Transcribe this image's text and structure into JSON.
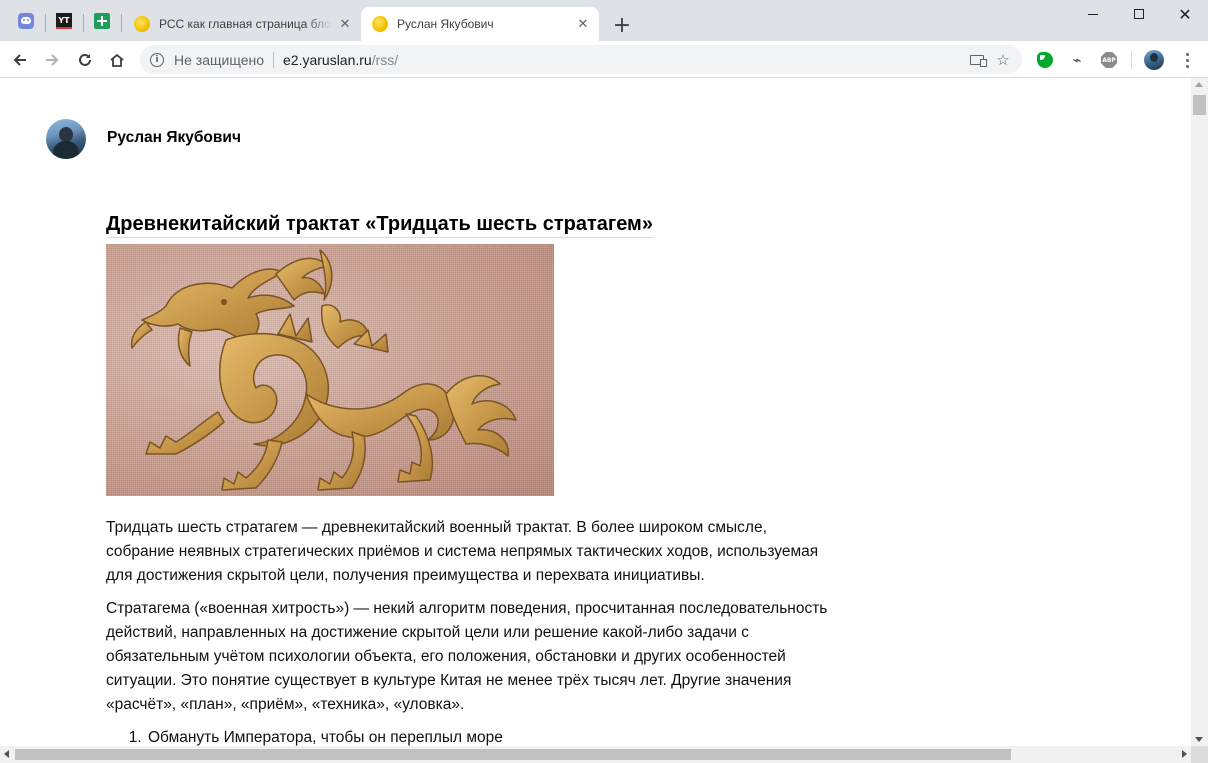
{
  "browser": {
    "pinned_tabs": [
      {
        "icon": "discord-icon"
      },
      {
        "icon": "yt-icon",
        "text": "YT"
      },
      {
        "icon": "green-plus-icon"
      }
    ],
    "tabs": [
      {
        "title": "РСС как главная страница блога",
        "active": false
      },
      {
        "title": "Руслан Якубович",
        "active": true
      }
    ],
    "security_label": "Не защищено",
    "url_host": "e2.yaruslan.ru",
    "url_path": "/rss/",
    "extensions": [
      "evernote-icon",
      "plug-icon",
      "adblock-icon"
    ],
    "adblock_text": "ABP"
  },
  "page": {
    "author": {
      "name": "Руслан Якубович"
    },
    "post": {
      "title": "Древнекитайский трактат «Тридцать шесть стратагем»",
      "image": "dragon-illustration",
      "paragraphs": [
        "Тридцать шесть стратагем — древнекитайский военный трактат. В более широком смысле, собрание неявных стратегических приёмов и система непрямых тактических ходов, используемая для достижения скрытой цели, получения преимущества и перехвата инициативы.",
        "Стратагема («военная хитрость») — некий алгоритм поведения, просчитанная последовательность действий, направленных на достижение скрытой цели или решение какой-либо задачи с обязательным учётом психологии объекта, его положения, обстановки и других особенностей ситуации. Это понятие существует в культуре Китая не менее трёх тысяч лет. Другие значения «расчёт», «план», «приём», «техника», «уловка»."
      ],
      "list": [
        "Обмануть Императора, чтобы он переплыл море"
      ]
    }
  },
  "colors": {
    "tabstrip": "#dee1e6",
    "omnibox": "#f1f3f4",
    "image_bg": "#cfa597",
    "dragon": "#c99a4c"
  }
}
